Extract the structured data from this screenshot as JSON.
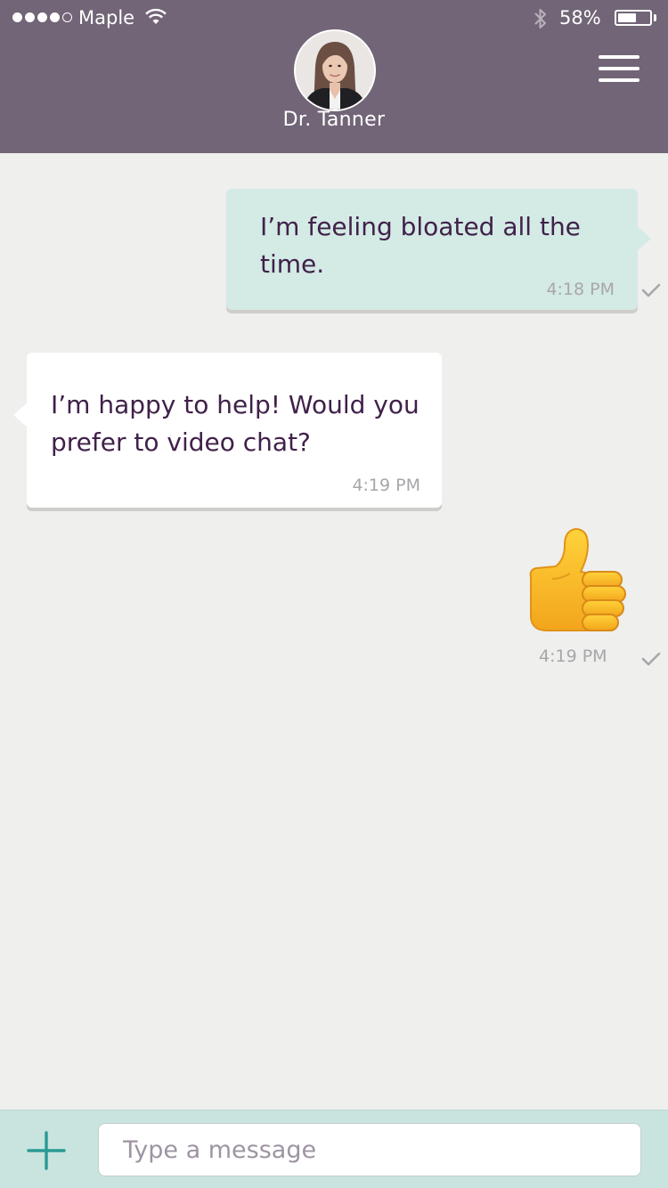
{
  "status_bar": {
    "carrier": "Maple",
    "battery_percent": "58%",
    "battery_level": 0.58,
    "signal_bars_filled": 4,
    "signal_bars_total": 5
  },
  "header": {
    "contact_name": "Dr. Tanner",
    "menu_icon": "hamburger-menu-icon"
  },
  "messages": [
    {
      "direction": "outgoing",
      "text": "I’m feeling bloated all the time.",
      "time": "4:18 PM",
      "status": "sent"
    },
    {
      "direction": "incoming",
      "text": "I’m happy to help! Would you prefer to video chat?",
      "time": "4:19 PM"
    },
    {
      "direction": "outgoing",
      "type": "emoji",
      "emoji": "thumbs-up-icon",
      "time": "4:19 PM",
      "status": "sent"
    }
  ],
  "composer": {
    "placeholder": "Type a message",
    "value": "",
    "add_icon": "plus-icon"
  },
  "colors": {
    "header_bg": "#726577",
    "chat_bg": "#efefed",
    "outgoing_bubble": "#d4eae5",
    "incoming_bubble": "#ffffff",
    "message_text": "#40214a",
    "accent": "#2a9a93",
    "composer_bg": "#c9e4df"
  }
}
